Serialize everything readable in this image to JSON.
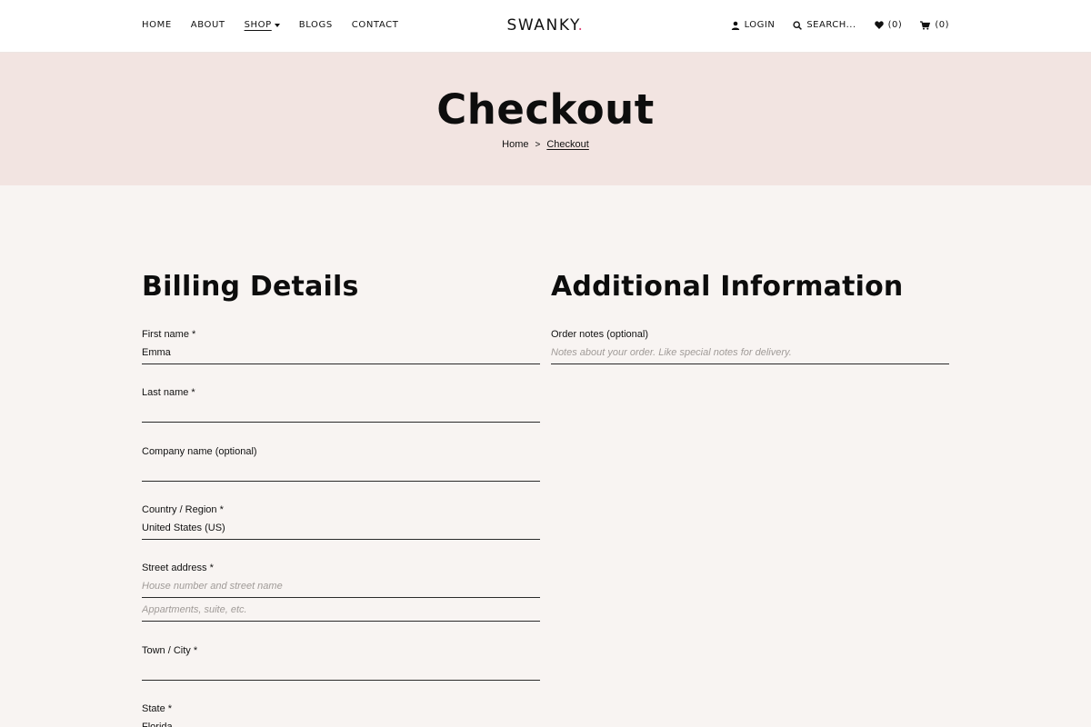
{
  "header": {
    "nav": [
      {
        "label": "HOME"
      },
      {
        "label": "ABOUT"
      },
      {
        "label": "SHOP"
      },
      {
        "label": "BLOGS"
      },
      {
        "label": "CONTACT"
      }
    ],
    "logo": {
      "text": "SWANKY",
      "dot": "."
    },
    "utility": {
      "login": "LOGIN",
      "search": "SEARCH...",
      "wishlist": "(0)",
      "cart": "(0)"
    }
  },
  "hero": {
    "title": "Checkout",
    "breadcrumb": {
      "home": "Home",
      "separator": ">",
      "current": "Checkout"
    }
  },
  "billing": {
    "title": "Billing Details",
    "first_name": {
      "label": "First name *",
      "value": "Emma"
    },
    "last_name": {
      "label": "Last name *",
      "value": ""
    },
    "company": {
      "label": "Company name (optional)",
      "value": ""
    },
    "country": {
      "label": "Country / Region *",
      "value": "United States (US)"
    },
    "street": {
      "label": "Street address *",
      "placeholder1": "House number and street name",
      "placeholder2": "Appartments, suite, etc."
    },
    "city": {
      "label": "Town / City *",
      "value": ""
    },
    "state": {
      "label": "State *",
      "value": "Florida"
    }
  },
  "additional": {
    "title": "Additional Information",
    "order_notes": {
      "label": "Order notes (optional)",
      "placeholder": "Notes about your order. Like special notes for delivery."
    }
  },
  "colors": {
    "hero_bg": "#f2e4e1",
    "page_bg": "#f8f4f2",
    "accent": "#e0467a"
  }
}
